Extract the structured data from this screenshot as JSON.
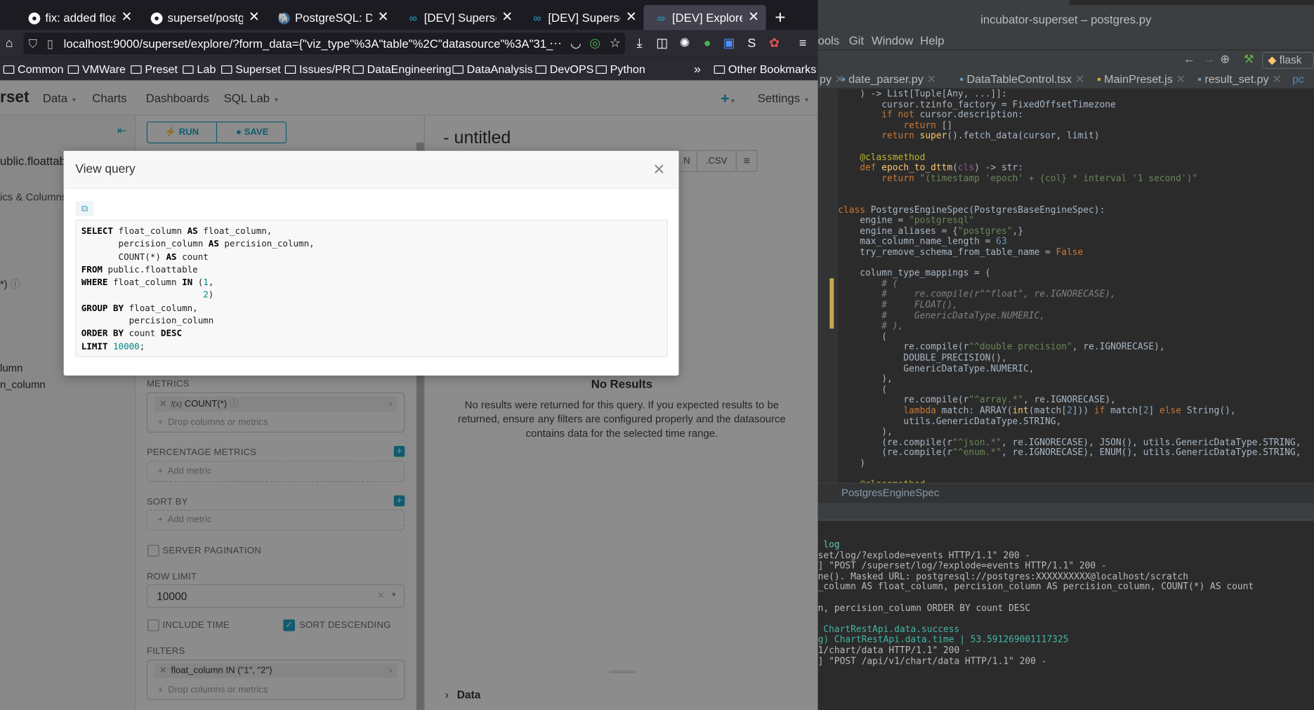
{
  "browser": {
    "tabs": [
      {
        "label": "fix: added float su",
        "icon": "github-icon"
      },
      {
        "label": "superset/postgre",
        "icon": "github-icon"
      },
      {
        "label": "PostgreSQL: Doc",
        "icon": "postgresql-icon"
      },
      {
        "label": "[DEV] Superset",
        "icon": "superset-icon"
      },
      {
        "label": "[DEV] Superset",
        "icon": "superset-icon"
      },
      {
        "label": "[DEV] Explore - fl",
        "icon": "superset-icon",
        "active": true
      }
    ],
    "url": "localhost:9000/superset/explore/?form_data={\"viz_type\"%3A\"table\"%2C\"datasource\"%3A\"31_",
    "url_host": "localhost",
    "bookmarks": [
      "Common",
      "VMWare",
      "Preset",
      "Lab",
      "Superset",
      "Issues/PR",
      "DataEngineering",
      "DataAnalysis",
      "DevOPS",
      "Python"
    ],
    "other_bookmarks": "Other Bookmarks"
  },
  "app": {
    "brand": "rset",
    "nav": [
      "Data",
      "Charts",
      "Dashboards",
      "SQL Lab"
    ],
    "settings": "Settings",
    "left": {
      "datasource": "ublic.floattabl",
      "tabs_label": "ics & Columns",
      "count_label": "*)",
      "col1": "lumn",
      "col2": "n_column"
    },
    "run_label": "RUN",
    "save_label": "SAVE",
    "chart_title": "- untitled",
    "csv_label": ".CSV",
    "metrics_label": "METRICS",
    "metric_item": "COUNT(*)",
    "metric_fx": "f(x)",
    "drop_placeholder": "Drop columns or metrics",
    "percentage_label": "PERCENTAGE METRICS",
    "add_metric": "Add metric",
    "sort_by_label": "SORT BY",
    "server_pagination": "SERVER PAGINATION",
    "row_limit_label": "ROW LIMIT",
    "row_limit_value": "10000",
    "include_time": "INCLUDE TIME",
    "sort_descending": "SORT DESCENDING",
    "filters_label": "FILTERS",
    "filter_item": "float_column IN (\"1\", \"2\")",
    "no_results_title": "No Results",
    "no_results_body": "No results were returned for this query. If you expected results to be returned, ensure any filters are configured properly and the datasource contains data for the selected time range.",
    "data_section": "Data"
  },
  "modal": {
    "title": "View query",
    "sql_lines": [
      [
        [
          "kw",
          "SELECT"
        ],
        [
          "t",
          " float_column "
        ],
        [
          "kw",
          "AS"
        ],
        [
          "t",
          " float_column,"
        ]
      ],
      [
        [
          "t",
          "       percision_column "
        ],
        [
          "kw",
          "AS"
        ],
        [
          "t",
          " percision_column,"
        ]
      ],
      [
        [
          "t",
          "       COUNT(*) "
        ],
        [
          "kw",
          "AS"
        ],
        [
          "t",
          " count"
        ]
      ],
      [
        [
          "kw",
          "FROM"
        ],
        [
          "t",
          " public.floattable"
        ]
      ],
      [
        [
          "kw",
          "WHERE"
        ],
        [
          "t",
          " float_column "
        ],
        [
          "kw",
          "IN"
        ],
        [
          "t",
          " ("
        ],
        [
          "num",
          "1"
        ],
        [
          "t",
          ","
        ]
      ],
      [
        [
          "t",
          "                       "
        ],
        [
          "num",
          "2"
        ],
        [
          "t",
          ")"
        ]
      ],
      [
        [
          "kw",
          "GROUP BY"
        ],
        [
          "t",
          " float_column,"
        ]
      ],
      [
        [
          "t",
          "         percision_column"
        ]
      ],
      [
        [
          "kw",
          "ORDER BY"
        ],
        [
          "t",
          " count "
        ],
        [
          "kw",
          "DESC"
        ]
      ],
      [
        [
          "kw",
          "LIMIT"
        ],
        [
          "t",
          " "
        ],
        [
          "num",
          "10000"
        ],
        [
          "t",
          ";"
        ]
      ]
    ]
  },
  "ide": {
    "title": "incubator-superset – postgres.py",
    "menu": [
      "ools",
      "Git",
      "Window",
      "Help"
    ],
    "run_config": "flask",
    "tabs": [
      "py",
      "date_parser.py",
      "DataTableControl.tsx",
      "MainPreset.js",
      "result_set.py",
      "pc"
    ],
    "code_lines": [
      [
        [
          "t",
          "    ) -> "
        ],
        [
          "t",
          "List[Tuple[Any, ...]]:"
        ]
      ],
      [
        [
          "t",
          "        cursor.tzinfo_factory = FixedOffsetTimezone"
        ]
      ],
      [
        [
          "k",
          "        if not "
        ],
        [
          "t",
          "cursor.description:"
        ]
      ],
      [
        [
          "k",
          "            return "
        ],
        [
          "t",
          "[]"
        ]
      ],
      [
        [
          "k",
          "        return "
        ],
        [
          "f",
          "super"
        ],
        [
          "t",
          "().fetch_data(cursor, limit)"
        ]
      ],
      [
        [
          "t",
          ""
        ]
      ],
      [
        [
          "d",
          "    @classmethod"
        ]
      ],
      [
        [
          "k",
          "    def "
        ],
        [
          "f",
          "epoch_to_dttm"
        ],
        [
          "t",
          "("
        ],
        [
          "p",
          "cls"
        ],
        [
          "t",
          ") -> "
        ],
        [
          "t",
          "str:"
        ]
      ],
      [
        [
          "k",
          "        return "
        ],
        [
          "s",
          "\"(timestamp 'epoch' + {col} * interval '1 second')\""
        ]
      ],
      [
        [
          "t",
          ""
        ]
      ],
      [
        [
          "t",
          ""
        ]
      ],
      [
        [
          "k",
          "class "
        ],
        [
          "t",
          "PostgresEngineSpec(PostgresBaseEngineSpec):"
        ]
      ],
      [
        [
          "t",
          "    engine = "
        ],
        [
          "s",
          "\"postgresql\""
        ]
      ],
      [
        [
          "t",
          "    engine_aliases = {"
        ],
        [
          "s",
          "\"postgres\""
        ],
        [
          "t",
          ",}"
        ]
      ],
      [
        [
          "t",
          "    max_column_name_length = "
        ],
        [
          "n",
          "63"
        ]
      ],
      [
        [
          "t",
          "    try_remove_schema_from_table_name = "
        ],
        [
          "k",
          "False"
        ]
      ],
      [
        [
          "t",
          ""
        ]
      ],
      [
        [
          "t",
          "    column_type_mappings = ("
        ]
      ],
      [
        [
          "c",
          "        # ("
        ]
      ],
      [
        [
          "c",
          "        #     re.compile(r\"^float\", re.IGNORECASE),"
        ]
      ],
      [
        [
          "c",
          "        #     FLOAT(),"
        ]
      ],
      [
        [
          "c",
          "        #     GenericDataType.NUMERIC,"
        ]
      ],
      [
        [
          "c",
          "        # ),"
        ]
      ],
      [
        [
          "t",
          "        ("
        ]
      ],
      [
        [
          "t",
          "            re.compile(r"
        ],
        [
          "s",
          "\"^double precision\""
        ],
        [
          "t",
          ", re.IGNORECASE),"
        ]
      ],
      [
        [
          "t",
          "            DOUBLE_PRECISION(),"
        ]
      ],
      [
        [
          "t",
          "            GenericDataType.NUMERIC,"
        ]
      ],
      [
        [
          "t",
          "        ),"
        ]
      ],
      [
        [
          "t",
          "        ("
        ]
      ],
      [
        [
          "t",
          "            re.compile(r"
        ],
        [
          "s",
          "\"^array.*\""
        ],
        [
          "t",
          ", re.IGNORECASE),"
        ]
      ],
      [
        [
          "k",
          "            lambda "
        ],
        [
          "t",
          "match: ARRAY("
        ],
        [
          "f",
          "int"
        ],
        [
          "t",
          "(match["
        ],
        [
          "n",
          "2"
        ],
        [
          "t",
          "])) "
        ],
        [
          "k",
          "if "
        ],
        [
          "t",
          "match["
        ],
        [
          "n",
          "2"
        ],
        [
          "t",
          "] "
        ],
        [
          "k",
          "else "
        ],
        [
          "t",
          "String(),"
        ]
      ],
      [
        [
          "t",
          "            utils.GenericDataType.STRING,"
        ]
      ],
      [
        [
          "t",
          "        ),"
        ]
      ],
      [
        [
          "t",
          "        (re.compile(r"
        ],
        [
          "s",
          "\"^json.*\""
        ],
        [
          "t",
          ", re.IGNORECASE), JSON(), utils.GenericDataType.STRING,"
        ]
      ],
      [
        [
          "t",
          "        (re.compile(r"
        ],
        [
          "s",
          "\"^enum.*\""
        ],
        [
          "t",
          ", re.IGNORECASE), ENUM(), utils.GenericDataType.STRING,"
        ]
      ],
      [
        [
          "t",
          "    )"
        ]
      ],
      [
        [
          "t",
          ""
        ]
      ],
      [
        [
          "d",
          "    @classmethod"
        ]
      ]
    ],
    "breadcrumb": "PostgresEngineSpec",
    "terminal_lines": [
      [
        [
          "g",
          " log"
        ]
      ],
      [
        [
          "t",
          "set/log/?explode=events HTTP/1.1\" 200 -"
        ]
      ],
      [
        [
          "t",
          "] \"POST /superset/log/?explode=events HTTP/1.1\" 200 -"
        ]
      ],
      [
        [
          "t",
          "ne(). Masked URL: postgresql://postgres:XXXXXXXXXX@localhost/scratch"
        ]
      ],
      [
        [
          "t",
          "_column AS float_column, percision_column AS percision_column, COUNT(*) AS count"
        ]
      ],
      [
        [
          "t",
          ""
        ]
      ],
      [
        [
          "t",
          "n, percision_column ORDER BY count DESC"
        ]
      ],
      [
        [
          "t",
          ""
        ]
      ],
      [
        [
          "ok",
          " ChartRestApi.data.success"
        ]
      ],
      [
        [
          "ok",
          "g) ChartRestApi.data.time | 53.591269001117325"
        ]
      ],
      [
        [
          "t",
          "1/chart/data HTTP/1.1\" 200 -"
        ]
      ],
      [
        [
          "t",
          "] \"POST /api/v1/chart/data HTTP/1.1\" 200 -"
        ]
      ]
    ]
  }
}
